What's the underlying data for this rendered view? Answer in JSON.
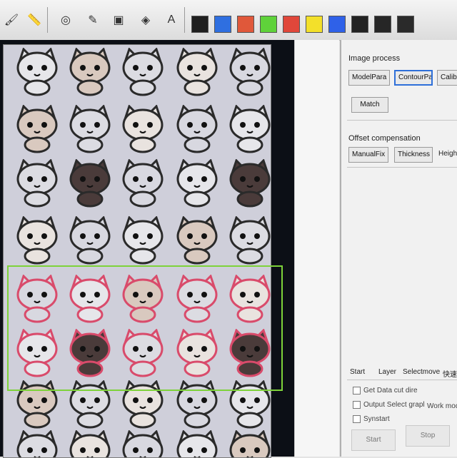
{
  "toolbar": {
    "tools": [
      {
        "name": "paint-brush-icon",
        "glyph": "🖌"
      },
      {
        "name": "ruler-icon",
        "glyph": "📏"
      },
      {
        "name": "node-edit-icon",
        "glyph": "◎"
      },
      {
        "name": "pen-tool-icon",
        "glyph": "✎"
      },
      {
        "name": "select-handles-icon",
        "glyph": "▣"
      },
      {
        "name": "rotate-handles-icon",
        "glyph": "◈"
      },
      {
        "name": "text-handles-icon",
        "glyph": "A"
      }
    ],
    "colors": [
      "#1f1f1f",
      "#2f6fe0",
      "#e0583a",
      "#5fd23a",
      "#e0473a",
      "#f3e02a",
      "#2f61e8",
      "#222222",
      "#262626",
      "#2a2a2a"
    ]
  },
  "panel": {
    "image_process": {
      "title": "Image process",
      "buttons": [
        "ModelPara",
        "ContourPara",
        "Calibra",
        "Match"
      ]
    },
    "offset_compensation": {
      "title": "Offset compensation",
      "buttons": [
        "ManualFix",
        "Thickness",
        "Height"
      ]
    },
    "tabs": [
      "Start",
      "Layer",
      "Selectmove",
      "快速"
    ],
    "options": [
      "Get Data cut dire",
      "Output Select grapl",
      "Synstart"
    ],
    "work_mode_label": "Work mode",
    "action_buttons": [
      "Start",
      "Stop"
    ]
  }
}
